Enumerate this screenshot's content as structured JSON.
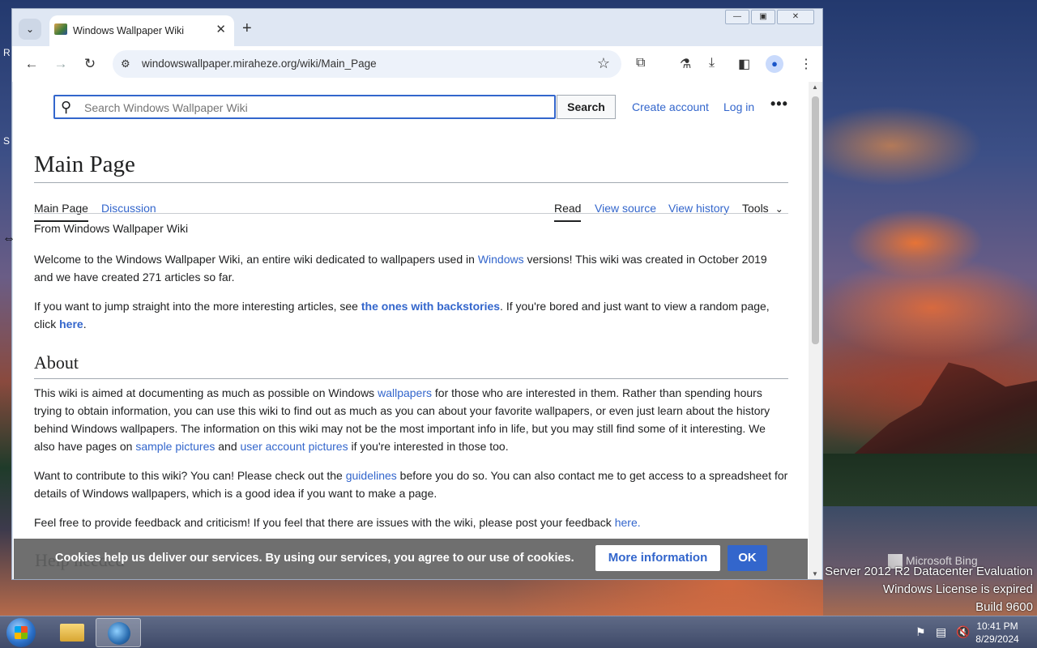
{
  "browser": {
    "tab_title": "Windows Wallpaper Wiki",
    "new_tab": "+",
    "url": "windowswallpaper.miraheze.org/wiki/Main_Page"
  },
  "wiki": {
    "search_placeholder": "Search Windows Wallpaper Wiki",
    "search_button": "Search",
    "create_account": "Create account",
    "log_in": "Log in",
    "more": "•••",
    "page_title": "Main Page",
    "tabs": {
      "main_page": "Main Page",
      "discussion": "Discussion",
      "read": "Read",
      "view_source": "View source",
      "view_history": "View history",
      "tools": "Tools"
    },
    "from": "From Windows Wallpaper Wiki",
    "p1": {
      "a": "Welcome to the Windows Wallpaper Wiki, an entire wiki dedicated to wallpapers used in ",
      "link": "Windows",
      "b": " versions! This wiki was created in October 2019 and we have created 271 articles so far."
    },
    "p2": {
      "a": "If you want to jump straight into the more interesting articles, see ",
      "link1": "the ones with backstories",
      "b": ". If you're bored and just want to view a random page, click ",
      "link2": "here",
      "c": "."
    },
    "about_heading": "About",
    "p3": {
      "a": "This wiki is aimed at documenting as much as possible on Windows ",
      "link1": "wallpapers",
      "b": " for those who are interested in them. Rather than spending hours trying to obtain information, you can use this wiki to find out as much as you can about your favorite wallpapers, or even just learn about the history behind Windows wallpapers. The information on this wiki may not be the most important info in life, but you may still find some of it interesting. We also have pages on ",
      "link2": "sample pictures",
      "c": " and ",
      "link3": "user account pictures",
      "d": " if you're interested in those too."
    },
    "p4": {
      "a": "Want to contribute to this wiki? You can! Please check out the ",
      "link": "guidelines",
      "b": " before you do so. You can also contact me to get access to a spreadsheet for details of Windows wallpapers, which is a good idea if you want to make a page."
    },
    "p5": {
      "a": "Feel free to provide feedback and criticism! If you feel that there are issues with the wiki, please post your feedback ",
      "link": "here."
    },
    "next_heading": "Help needed"
  },
  "cookie": {
    "message": "Cookies help us deliver our services. By using our services, you agree to our use of cookies.",
    "more_info": "More information",
    "ok": "OK"
  },
  "desktop": {
    "bing": "Microsoft Bing",
    "line1": "s Server 2012 R2 Datacenter Evaluation",
    "line2": "Windows License is expired",
    "line3": "Build 9600",
    "edge1": "R",
    "edge2": "S"
  },
  "taskbar": {
    "time": "10:41 PM",
    "date": "8/29/2024"
  },
  "icons": [
    "tab-list-icon",
    "favicon-icon",
    "close-icon",
    "back-icon",
    "forward-icon",
    "reload-icon",
    "site-info-icon",
    "star-icon",
    "extensions-icon",
    "labs-icon",
    "download-icon",
    "side-panel-icon",
    "profile-icon",
    "menu-icon",
    "search-icon",
    "chevron-down-icon",
    "start-icon",
    "file-explorer-icon",
    "browser-icon",
    "flag-icon",
    "network-icon",
    "volume-muted-icon"
  ]
}
